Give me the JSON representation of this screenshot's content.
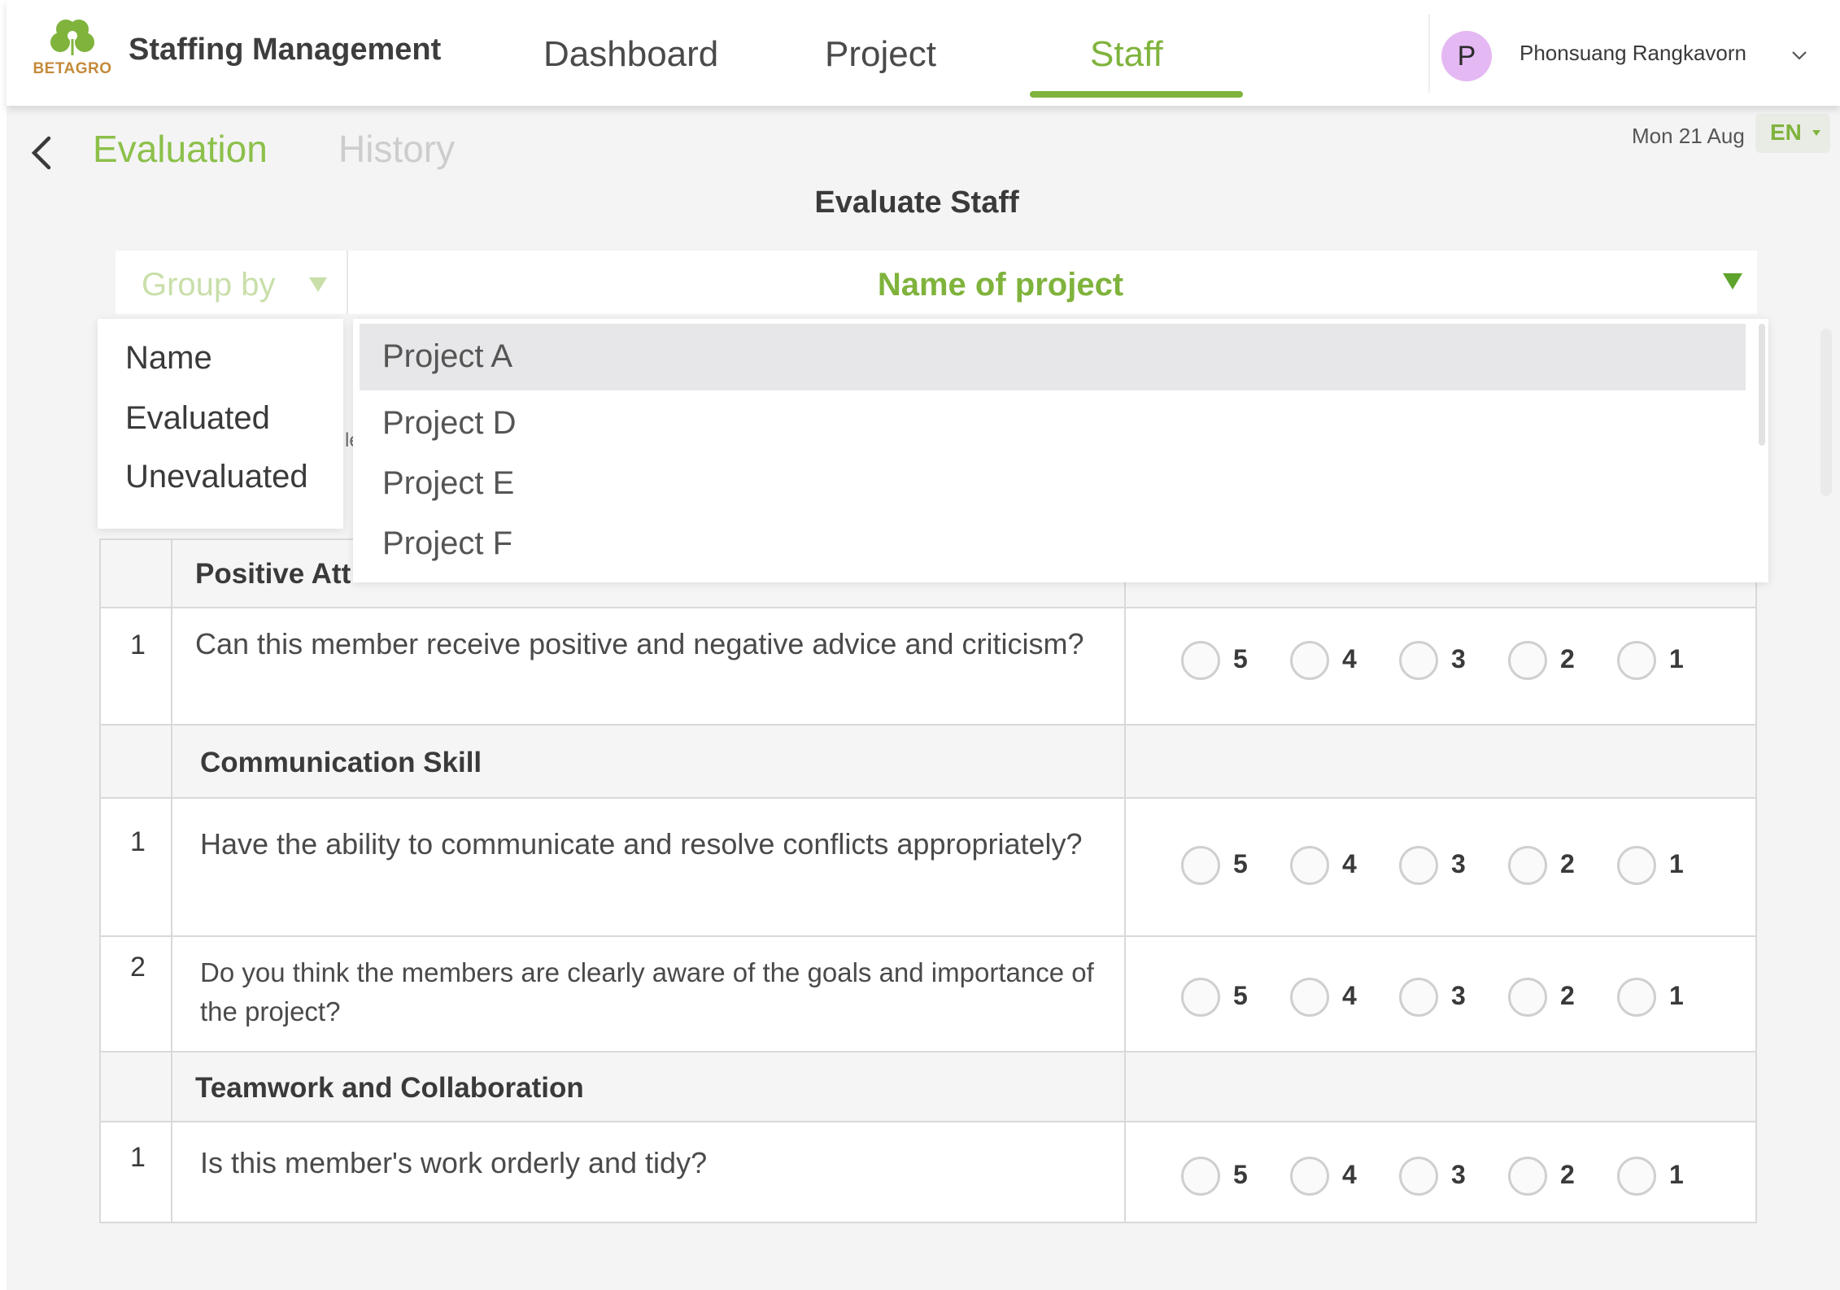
{
  "header": {
    "logo_text": "BETAGRO",
    "app_title": "Staffing Management",
    "nav": [
      "Dashboard",
      "Project",
      "Staff"
    ],
    "active_nav": "Staff",
    "user": {
      "initial": "P",
      "name": "Phonsuang Rangkavorn"
    }
  },
  "subnav": {
    "tabs": [
      "Evaluation",
      "History"
    ],
    "active_tab": "Evaluation",
    "date": "Mon 21 Aug",
    "language": "EN"
  },
  "page_title": "Evaluate Staff",
  "filters": {
    "group_by_label": "Group by",
    "project_label": "Name of project"
  },
  "group_by_options": [
    "Name",
    "Evaluated",
    "Unevaluated"
  ],
  "project_options": [
    "Project A",
    "Project D",
    "Project E",
    "Project F"
  ],
  "selected_project_option": "Project A",
  "underlay_fragment": "le",
  "score_scale": [
    "5",
    "4",
    "3",
    "2",
    "1"
  ],
  "sections": [
    {
      "title": "Positive Att",
      "questions": [
        {
          "no": "1",
          "text": "Can this member receive positive and negative advice and criticism?"
        }
      ]
    },
    {
      "title": "Communication Skill",
      "questions": [
        {
          "no": "1",
          "text": "Have the ability to communicate and resolve conflicts appropriately?"
        },
        {
          "no": "2",
          "text": "Do you think the members are clearly aware of the goals and importance of the project?"
        }
      ]
    },
    {
      "title": "Teamwork and Collaboration",
      "questions": [
        {
          "no": "1",
          "text": "Is this member's work orderly and tidy?"
        }
      ]
    }
  ],
  "colors": {
    "brand_green": "#7fb33c",
    "light_green": "#c9dfaa",
    "avatar_bg": "#e4b8f3",
    "logo_text": "#c48a3a"
  }
}
